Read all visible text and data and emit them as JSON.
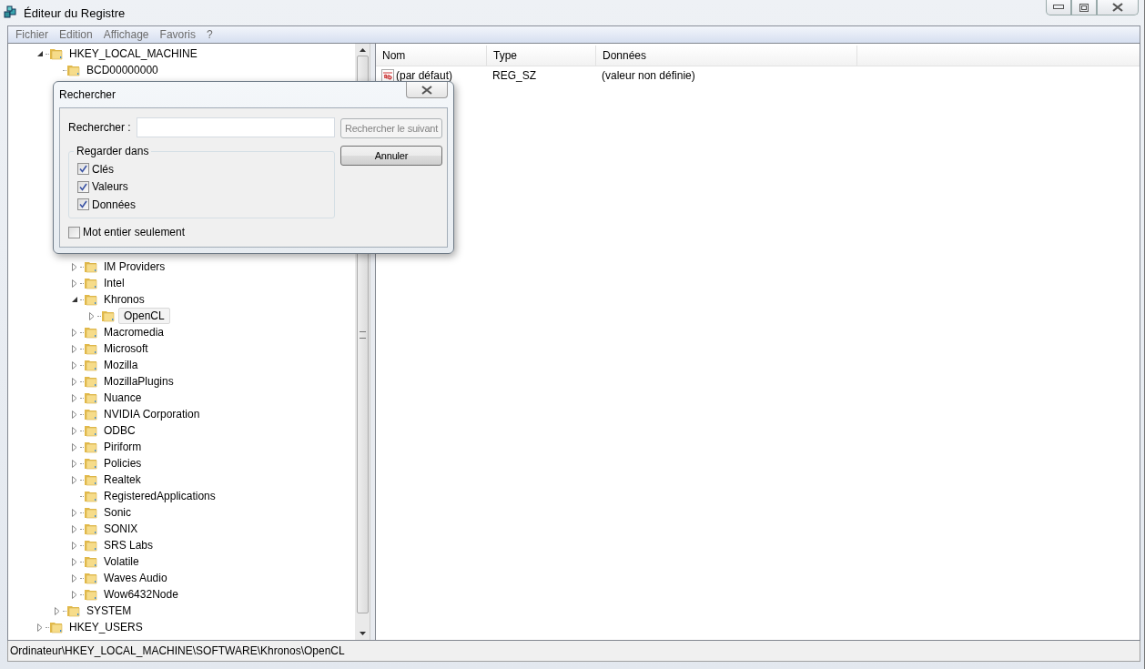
{
  "window": {
    "title": "Éditeur du Registre"
  },
  "menu": [
    "Fichier",
    "Edition",
    "Affichage",
    "Favoris",
    "?"
  ],
  "tree": {
    "nodes": [
      {
        "label": "HKEY_LOCAL_MACHINE",
        "kind": "branch",
        "expanded": true,
        "selected": false,
        "children": [
          {
            "label": "BCD00000000",
            "kind": "leaf",
            "expanded": false,
            "selected": false
          },
          {
            "children": [
              {
                "label": "IM Providers",
                "kind": "branch",
                "expanded": false,
                "selected": false
              },
              {
                "label": "Intel",
                "kind": "branch",
                "expanded": false,
                "selected": false
              },
              {
                "label": "Khronos",
                "kind": "branch",
                "expanded": true,
                "selected": false,
                "children": [
                  {
                    "label": "OpenCL",
                    "kind": "branch",
                    "expanded": false,
                    "selected": true
                  }
                ]
              },
              {
                "label": "Macromedia",
                "kind": "branch",
                "expanded": false,
                "selected": false
              },
              {
                "label": "Microsoft",
                "kind": "branch",
                "expanded": false,
                "selected": false
              },
              {
                "label": "Mozilla",
                "kind": "branch",
                "expanded": false,
                "selected": false
              },
              {
                "label": "MozillaPlugins",
                "kind": "branch",
                "expanded": false,
                "selected": false
              },
              {
                "label": "Nuance",
                "kind": "branch",
                "expanded": false,
                "selected": false
              },
              {
                "label": "NVIDIA Corporation",
                "kind": "branch",
                "expanded": false,
                "selected": false
              },
              {
                "label": "ODBC",
                "kind": "branch",
                "expanded": false,
                "selected": false
              },
              {
                "label": "Piriform",
                "kind": "branch",
                "expanded": false,
                "selected": false
              },
              {
                "label": "Policies",
                "kind": "branch",
                "expanded": false,
                "selected": false
              },
              {
                "label": "Realtek",
                "kind": "branch",
                "expanded": false,
                "selected": false
              },
              {
                "label": "RegisteredApplications",
                "kind": "leaf",
                "expanded": false,
                "selected": false
              },
              {
                "label": "Sonic",
                "kind": "branch",
                "expanded": false,
                "selected": false
              },
              {
                "label": "SONIX",
                "kind": "branch",
                "expanded": false,
                "selected": false
              },
              {
                "label": "SRS Labs",
                "kind": "branch",
                "expanded": false,
                "selected": false
              },
              {
                "label": "Volatile",
                "kind": "branch",
                "expanded": false,
                "selected": false
              },
              {
                "label": "Waves Audio",
                "kind": "branch",
                "expanded": false,
                "selected": false
              },
              {
                "label": "Wow6432Node",
                "kind": "branch",
                "expanded": false,
                "selected": false
              }
            ]
          },
          {
            "label": "SYSTEM",
            "kind": "branch",
            "expanded": false,
            "selected": false
          }
        ]
      },
      {
        "label": "HKEY_USERS",
        "kind": "branch",
        "expanded": false,
        "selected": false
      }
    ]
  },
  "values_table": {
    "columns": [
      "Nom",
      "Type",
      "Données"
    ],
    "rows": [
      {
        "name": "(par défaut)",
        "type": "REG_SZ",
        "data": "(valeur non définie)"
      }
    ]
  },
  "status_bar": "Ordinateur\\HKEY_LOCAL_MACHINE\\SOFTWARE\\Khronos\\OpenCL",
  "find_dialog": {
    "title": "Rechercher",
    "search_label": "Rechercher :",
    "find_next": {
      "label": "Rechercher le suivant",
      "disabled": true
    },
    "cancel": {
      "label": "Annuler",
      "disabled": false
    },
    "group_label": "Regarder dans",
    "options": [
      {
        "label": "Clés",
        "checked": true
      },
      {
        "label": "Valeurs",
        "checked": true
      },
      {
        "label": "Données",
        "checked": true
      }
    ],
    "whole_word": {
      "label": "Mot entier seulement",
      "checked": false
    }
  }
}
